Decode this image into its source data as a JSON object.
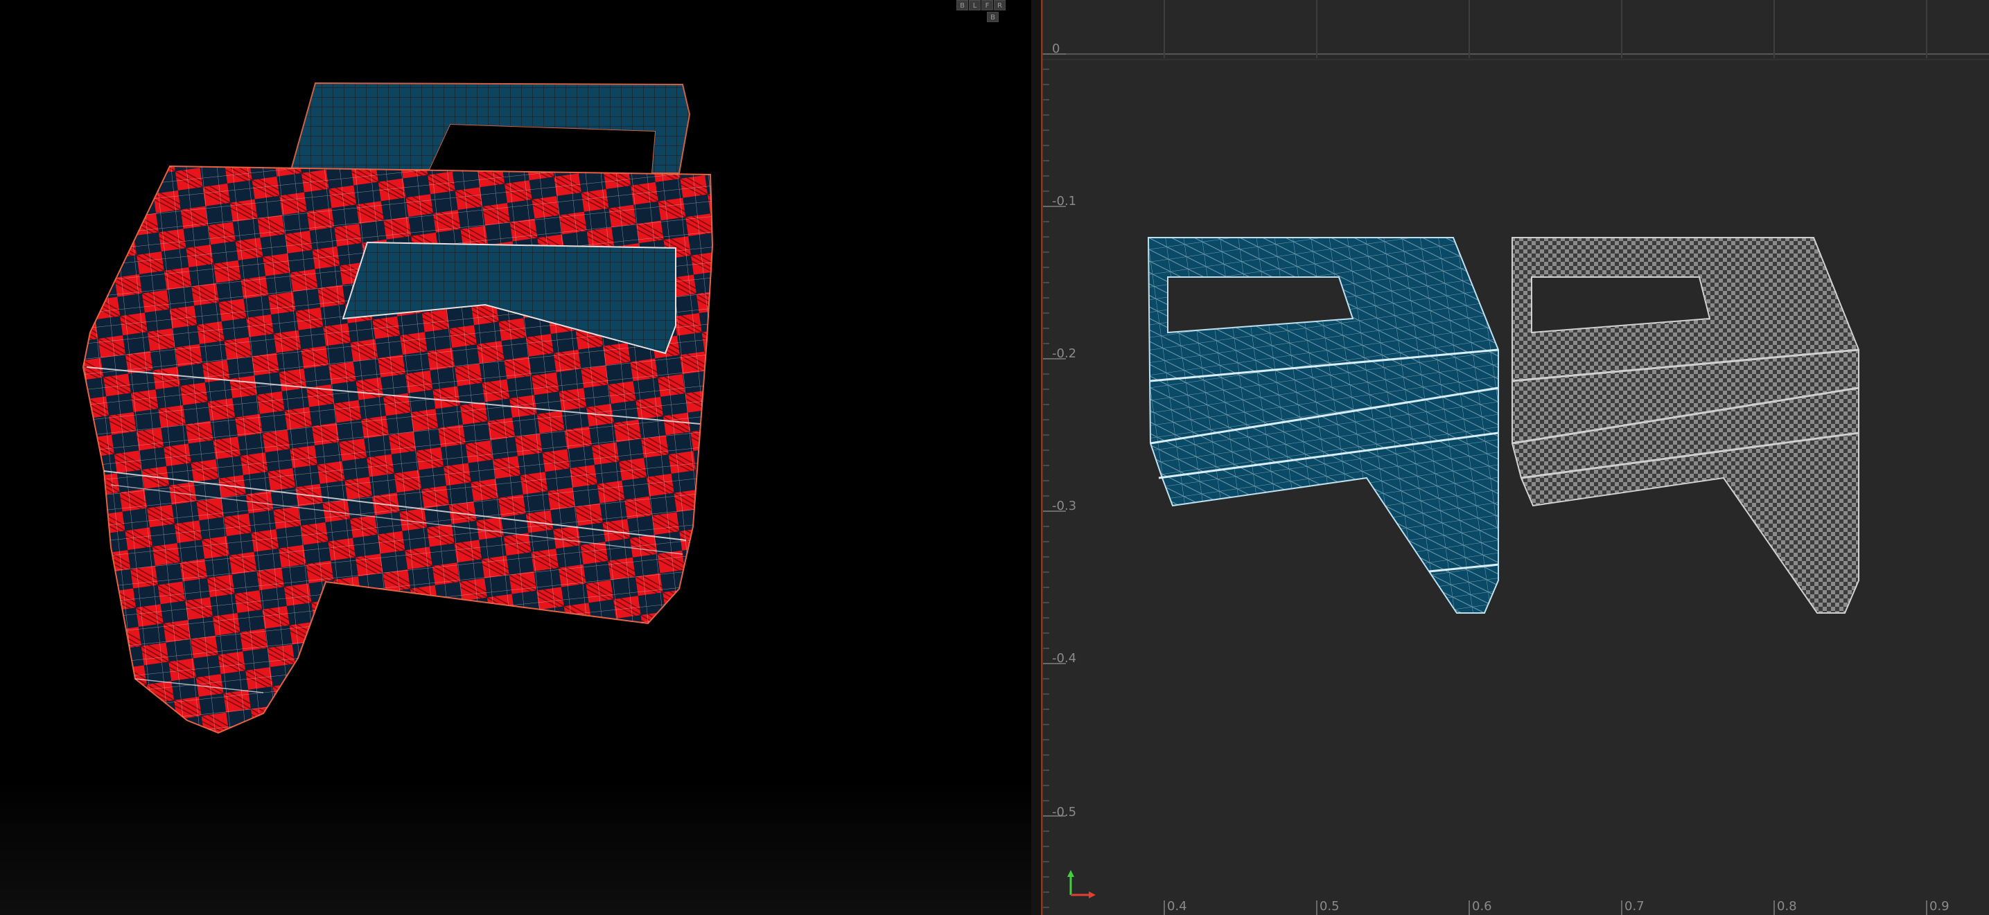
{
  "viewport_3d": {
    "view_buttons": [
      "B",
      "L",
      "F",
      "R",
      "B"
    ]
  },
  "uv_editor": {
    "u_ticks": [
      "0.4",
      "0.5",
      "0.6",
      "0.7",
      "0.8",
      "0.9"
    ],
    "v_ticks": [
      "0",
      "-0.1",
      "-0.2",
      "-0.3",
      "-0.4",
      "-0.5"
    ],
    "axis_colors": {
      "u": "#e04030",
      "v": "#40d040"
    },
    "shell_colors": {
      "selected": "#0a4a66",
      "checker": "#8a8a8a",
      "background": "#282828"
    }
  }
}
